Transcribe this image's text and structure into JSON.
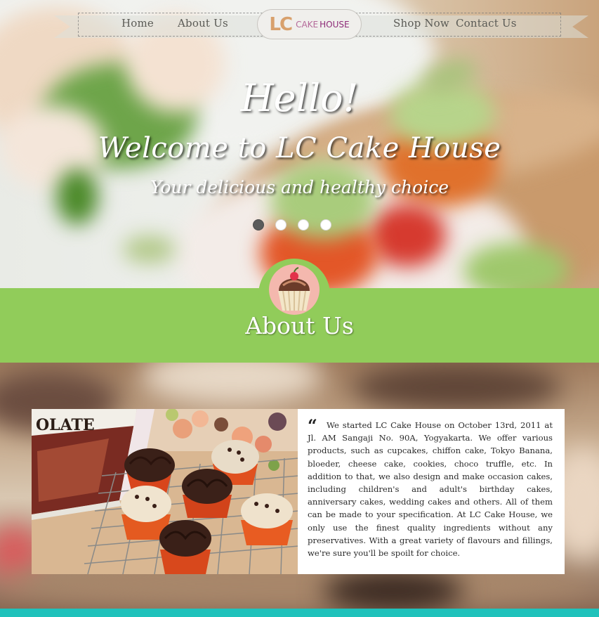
{
  "nav": {
    "home": "Home",
    "about": "About Us",
    "shop": "Shop Now",
    "contact": "Contact Us",
    "logo_lc": "LC",
    "logo_cake": "CAKE",
    "logo_house": "HOUSE"
  },
  "hero": {
    "hello": "Hello!",
    "welcome": "Welcome to LC Cake House",
    "tagline": "Your delicious and healthy choice",
    "slides": 4,
    "active_slide": 1
  },
  "about": {
    "title": "About Us",
    "icon": "cupcake-icon",
    "quote": "We started LC Cake House on October 13rd, 2011 at Jl. AM Sangaji No. 90A, Yogyakarta. We offer various products, such as cupcakes, chiffon cake, Tokyo Banana, bloeder, cheese cake, cookies, choco truffle, etc. In addition to that, we also design and make occasion cakes, including children's and adult's birthday cakes, anniversary cakes, wedding cakes and others. All of them can be made to your specification. At LC Cake House, we only use the finest quality ingredients without any preservatives. With a great variety of flavours and fillings, we're sure you'll be spoilt for choice.",
    "book_title": "OLATE"
  },
  "colors": {
    "about_green": "#91cc5a",
    "footer_teal": "#1fc2bb",
    "logo_orange": "#d8a06c",
    "logo_purple": "#8e2b78"
  }
}
